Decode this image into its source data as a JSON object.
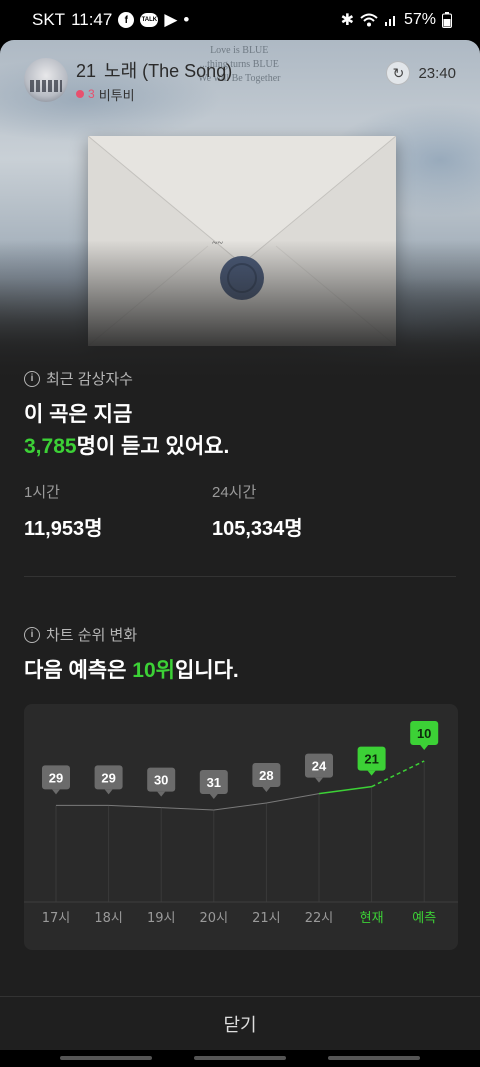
{
  "status_bar": {
    "carrier": "SKT",
    "time": "11:47",
    "battery": "57%"
  },
  "hero": {
    "lines": [
      "Love is BLUE",
      "...thing turns BLUE",
      "We will Be Together"
    ]
  },
  "header": {
    "rank": "21",
    "title": "노래 (The Song)",
    "artist": "비투비",
    "rank_change": "3",
    "refresh_icon": "refresh-icon",
    "time": "23:40"
  },
  "listeners": {
    "label": "최근 감상자수",
    "line1": "이 곡은 지금",
    "count": "3,785",
    "line2_suffix": "명이 듣고 있어요.",
    "stats": [
      {
        "label": "1시간",
        "value": "11,953명"
      },
      {
        "label": "24시간",
        "value": "105,334명"
      }
    ]
  },
  "chart_section": {
    "label": "차트 순위 변화",
    "prefix": "다음 예측은 ",
    "predicted": "10위",
    "suffix": "입니다."
  },
  "colors": {
    "accent": "#3cd136",
    "background": "#1f1f1f",
    "chart_bg": "#2a2a2a",
    "badge_gray": "#6b6b6b"
  },
  "chart_data": {
    "type": "line",
    "categories": [
      "17시",
      "18시",
      "19시",
      "20시",
      "21시",
      "22시",
      "현재",
      "예측"
    ],
    "values": [
      29,
      29,
      30,
      31,
      28,
      24,
      21,
      10
    ],
    "highlight_indices": [
      6,
      7
    ],
    "predicted_index": 7,
    "y_inverted": true,
    "grid": "vertical",
    "title": "",
    "xlabel": "",
    "ylabel": ""
  },
  "footer": {
    "close_label": "닫기"
  }
}
